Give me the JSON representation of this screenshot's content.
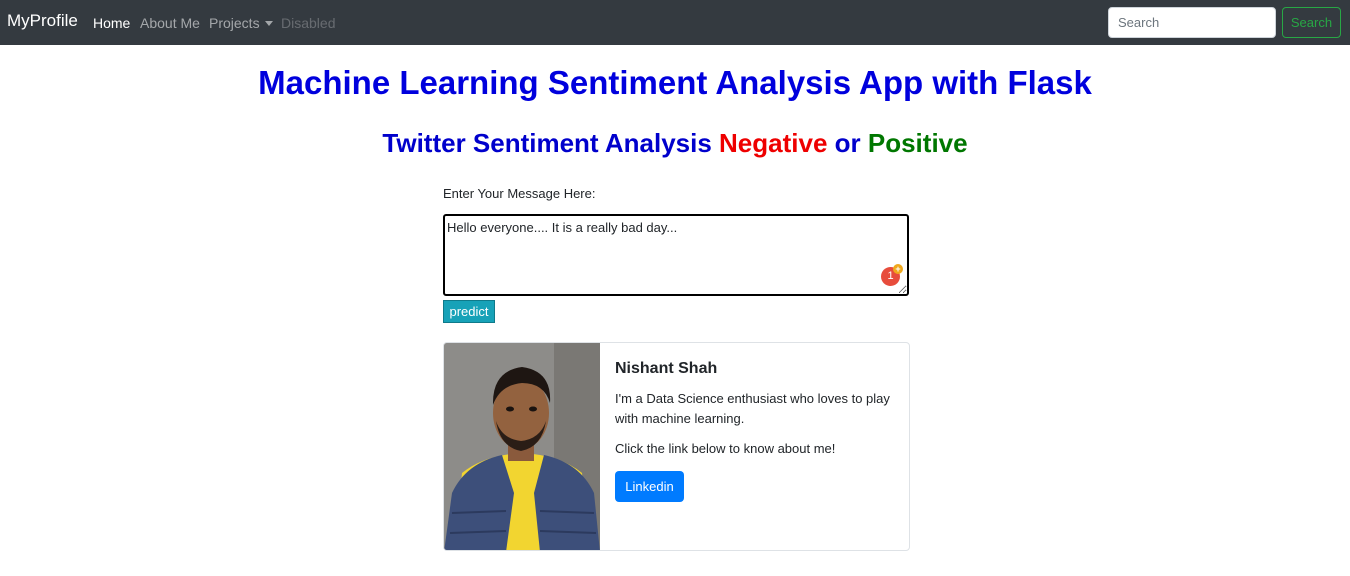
{
  "navbar": {
    "brand": "MyProfile",
    "links": [
      "Home",
      "About Me",
      "Projects",
      "Disabled"
    ],
    "search_placeholder": "Search",
    "search_button": "Search"
  },
  "heading": {
    "title": "Machine Learning Sentiment Analysis App with Flask",
    "subtitle_prefix": "Twitter Sentiment Analysis ",
    "negative": "Negative",
    "or": " or ",
    "positive": "Positive"
  },
  "form": {
    "label": "Enter Your Message Here:",
    "message": "Hello everyone.... It is a really bad day...",
    "extension_badge_count": "1",
    "predict_button": "predict"
  },
  "card": {
    "name": "Nishant Shah",
    "bio": "I'm a Data Science enthusiast who loves to play with machine learning.",
    "cta": "Click the link below to know about me!",
    "button": "Linkedin"
  },
  "colors": {
    "navbar_bg": "#343a40",
    "title_blue": "#0000dd",
    "negative_red": "#ee0000",
    "positive_green": "#007700",
    "predict_teal": "#17a2b8",
    "linkedin_blue": "#007bff",
    "search_green": "#28a745"
  }
}
